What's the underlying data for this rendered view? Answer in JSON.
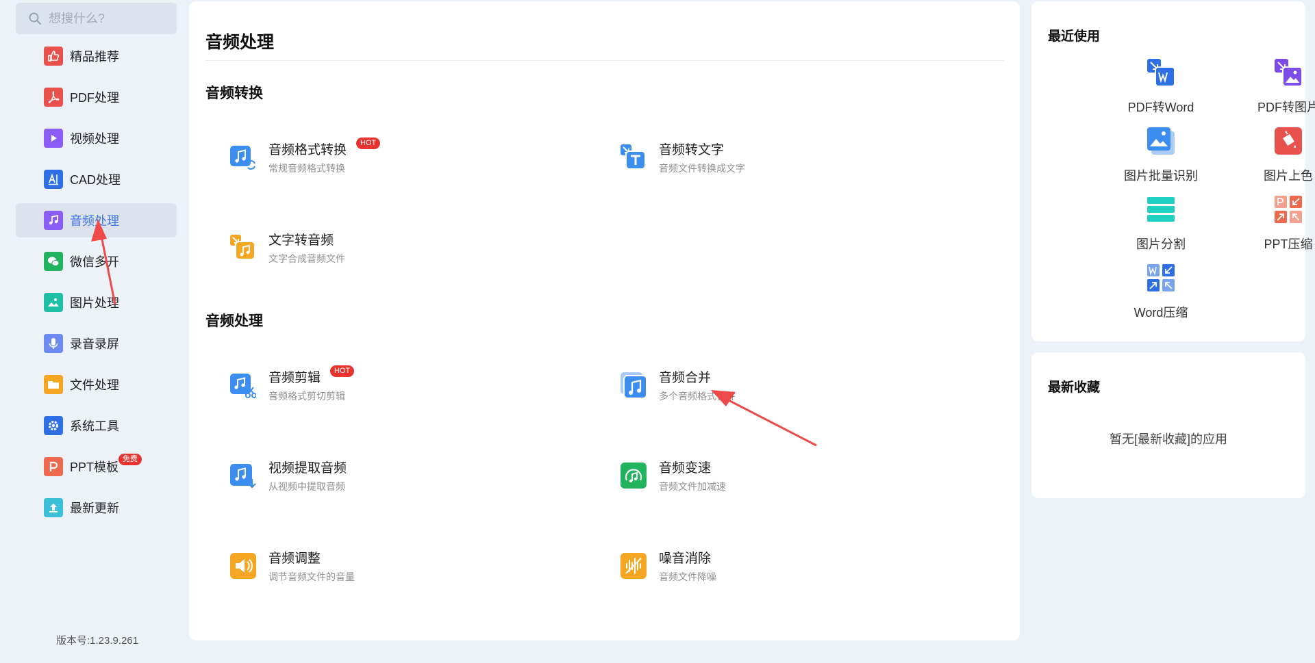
{
  "search": {
    "placeholder": "想搜什么?"
  },
  "sidebar": {
    "items": [
      {
        "label": "精品推荐",
        "icon": "thumbs-up-icon",
        "color": "#e9514d"
      },
      {
        "label": "PDF处理",
        "icon": "pdf-icon",
        "color": "#e9514d"
      },
      {
        "label": "视频处理",
        "icon": "play-icon",
        "color": "#8b5cf6"
      },
      {
        "label": "CAD处理",
        "icon": "cad-icon",
        "color": "#2f6fe4"
      },
      {
        "label": "音频处理",
        "icon": "music-note-icon",
        "color": "#8b5cf6"
      },
      {
        "label": "微信多开",
        "icon": "wechat-icon",
        "color": "#22b35e"
      },
      {
        "label": "图片处理",
        "icon": "image-icon",
        "color": "#1fbfa6"
      },
      {
        "label": "录音录屏",
        "icon": "microphone-icon",
        "color": "#6d8af0"
      },
      {
        "label": "文件处理",
        "icon": "folder-icon",
        "color": "#f5a623"
      },
      {
        "label": "系统工具",
        "icon": "gear-icon",
        "color": "#2f6fe4"
      },
      {
        "label": "PPT模板",
        "icon": "ppt-icon",
        "color": "#ee6a4f",
        "badge": "免费"
      },
      {
        "label": "最新更新",
        "icon": "upload-icon",
        "color": "#3cc0d8"
      }
    ],
    "version": "版本号:1.23.9.261"
  },
  "main": {
    "title": "音频处理",
    "sections": [
      {
        "title": "音频转换",
        "tools": [
          {
            "name": "音频格式转换",
            "desc": "常规音频格式转换",
            "hot": "HOT",
            "icon": "audio-convert-icon",
            "color": "#3b8ef0"
          },
          {
            "name": "音频转文字",
            "desc": "音频文件转换成文字",
            "icon": "audio-to-text-icon",
            "color": "#3b8ef0"
          },
          {
            "name": "文字转音频",
            "desc": "文字合成音频文件",
            "icon": "text-to-audio-icon",
            "color": "#f5a623"
          }
        ]
      },
      {
        "title": "音频处理",
        "tools": [
          {
            "name": "音频剪辑",
            "desc": "音频格式剪切剪辑",
            "hot": "HOT",
            "icon": "audio-cut-icon",
            "color": "#3b8ef0"
          },
          {
            "name": "音频合并",
            "desc": "多个音频格式合并",
            "icon": "audio-merge-icon",
            "color": "#3b8ef0"
          },
          {
            "name": "视频提取音频",
            "desc": "从视频中提取音频",
            "icon": "video-extract-audio-icon",
            "color": "#3b8ef0"
          },
          {
            "name": "音频变速",
            "desc": "音频文件加减速",
            "icon": "audio-speed-icon",
            "color": "#22b35e"
          },
          {
            "name": "音频调整",
            "desc": "调节音频文件的音量",
            "icon": "volume-icon",
            "color": "#f5a623"
          },
          {
            "name": "噪音消除",
            "desc": "音频文件降噪",
            "icon": "noise-reduction-icon",
            "color": "#f5a623"
          }
        ]
      }
    ]
  },
  "recent": {
    "title": "最近使用",
    "items": [
      {
        "label": "PDF转Word",
        "icon": "pdf-to-word-icon",
        "color": "#2f6fe4"
      },
      {
        "label": "PDF转图片",
        "icon": "pdf-to-image-icon",
        "color": "#7b4ce8"
      },
      {
        "label": "图片批量识别",
        "icon": "image-ocr-icon",
        "color": "#3b8ef0"
      },
      {
        "label": "图片上色",
        "icon": "paint-bucket-icon",
        "color": "#e9514d"
      },
      {
        "label": "图片分割",
        "icon": "image-split-icon",
        "color": "#1fcfc0"
      },
      {
        "label": "PPT压缩",
        "icon": "ppt-compress-icon",
        "color": "#ee6a4f"
      },
      {
        "label": "Word压缩",
        "icon": "word-compress-icon",
        "color": "#2f6fe4"
      }
    ]
  },
  "favorites": {
    "title": "最新收藏",
    "empty": "暂无[最新收藏]的应用"
  },
  "colors": {
    "accent": "#3f73e8",
    "hot": "#e8332f",
    "arrow": "#ee4a4a"
  }
}
